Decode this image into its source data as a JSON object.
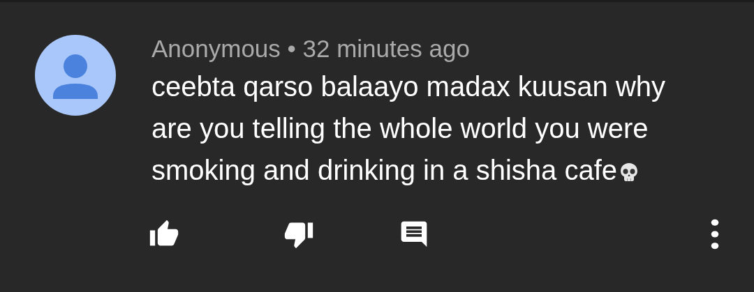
{
  "comment": {
    "meta": "Anonymous • 32 minutes ago",
    "text": "ceebta qarso balaayo madax kuusan why are you telling the whole world you were smoking and drinking in a shisha cafe"
  }
}
